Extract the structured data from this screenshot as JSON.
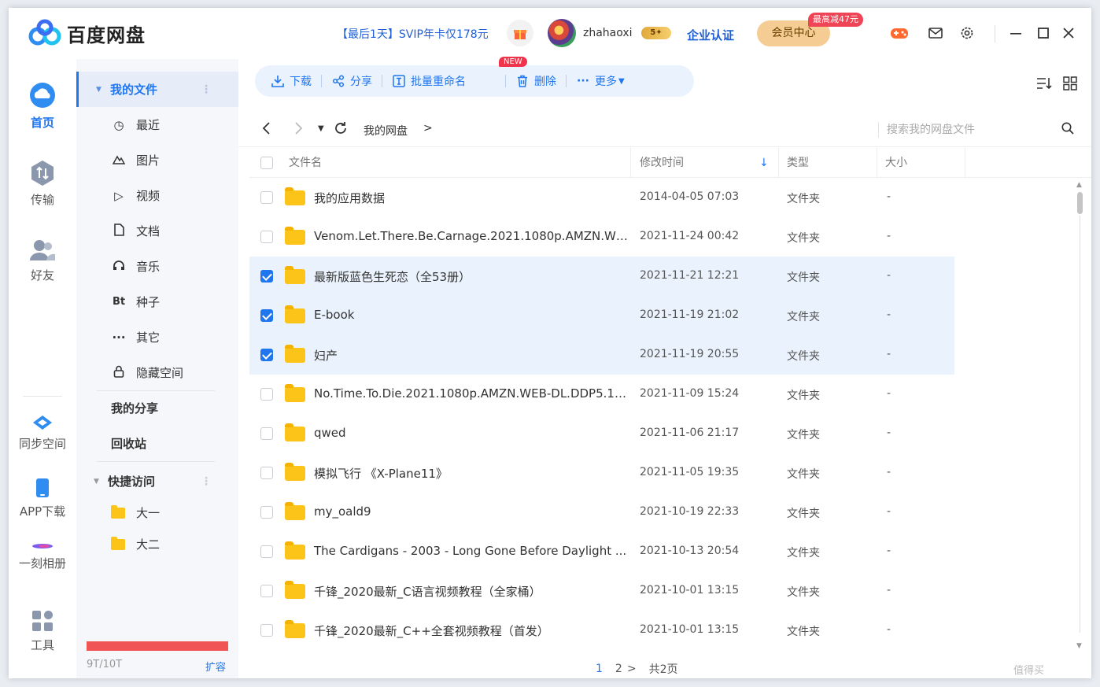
{
  "app": {
    "name": "百度网盘"
  },
  "header": {
    "promo": "【最后1天】SVIP年卡仅178元",
    "username": "zhahaoxi",
    "vip_level": "5",
    "enterprise": "企业认证",
    "member_center": "会员中心",
    "member_tag": "最高减47元"
  },
  "leftnav": {
    "items": [
      {
        "label": "首页",
        "active": true
      },
      {
        "label": "传输"
      },
      {
        "label": "好友"
      },
      {
        "label": "同步空间"
      },
      {
        "label": "APP下载"
      },
      {
        "label": "一刻相册"
      },
      {
        "label": "工具"
      }
    ]
  },
  "sidebar": {
    "my_files": "我的文件",
    "items": [
      "最近",
      "图片",
      "视频",
      "文档",
      "音乐",
      "种子",
      "其它",
      "隐藏空间"
    ],
    "bt_glyph": "Bt",
    "my_share": "我的分享",
    "recycle": "回收站",
    "quick_access": "快捷访问",
    "quick_items": [
      "大一",
      "大二"
    ],
    "quota": "9T/10T",
    "quota_fraction": 0.9,
    "expand": "扩容"
  },
  "toolbar": {
    "download": "下载",
    "share": "分享",
    "batch_rename": "批量重命名",
    "new_tag": "NEW",
    "delete": "删除",
    "more": "更多"
  },
  "path": {
    "crumb": "我的网盘",
    "search_placeholder": "搜索我的网盘文件"
  },
  "table": {
    "headers": {
      "name": "文件名",
      "modified": "修改时间",
      "type": "类型",
      "size": "大小"
    },
    "rows": [
      {
        "name": "我的应用数据",
        "date": "2014-04-05 07:03",
        "type": "文件夹",
        "size": "-",
        "selected": false
      },
      {
        "name": "Venom.Let.There.Be.Carnage.2021.1080p.AMZN.WE...",
        "date": "2021-11-24 00:42",
        "type": "文件夹",
        "size": "-",
        "selected": false
      },
      {
        "name": "最新版蓝色生死恋（全53册）",
        "date": "2021-11-21 12:21",
        "type": "文件夹",
        "size": "-",
        "selected": true
      },
      {
        "name": "E-book",
        "date": "2021-11-19 21:02",
        "type": "文件夹",
        "size": "-",
        "selected": true
      },
      {
        "name": "妇产",
        "date": "2021-11-19 20:55",
        "type": "文件夹",
        "size": "-",
        "selected": true
      },
      {
        "name": "No.Time.To.Die.2021.1080p.AMZN.WEB-DL.DDP5.1....",
        "date": "2021-11-09 15:24",
        "type": "文件夹",
        "size": "-",
        "selected": false
      },
      {
        "name": "qwed",
        "date": "2021-11-06 21:17",
        "type": "文件夹",
        "size": "-",
        "selected": false
      },
      {
        "name": "模拟飞行 《X-Plane11》",
        "date": "2021-11-05 19:35",
        "type": "文件夹",
        "size": "-",
        "selected": false
      },
      {
        "name": "my_oald9",
        "date": "2021-10-19 22:33",
        "type": "文件夹",
        "size": "-",
        "selected": false
      },
      {
        "name": "The Cardigans - 2003 - Long Gone Before Daylight ...",
        "date": "2021-10-13 20:54",
        "type": "文件夹",
        "size": "-",
        "selected": false
      },
      {
        "name": "千锋_2020最新_C语言视频教程（全家桶）",
        "date": "2021-10-01 13:15",
        "type": "文件夹",
        "size": "-",
        "selected": false
      },
      {
        "name": "千锋_2020最新_C++全套视频教程（首发）",
        "date": "2021-10-01 13:15",
        "type": "文件夹",
        "size": "-",
        "selected": false
      }
    ]
  },
  "pager": {
    "page1": "1",
    "page2": "2",
    "total": "共2页"
  },
  "watermark": "值得买"
}
